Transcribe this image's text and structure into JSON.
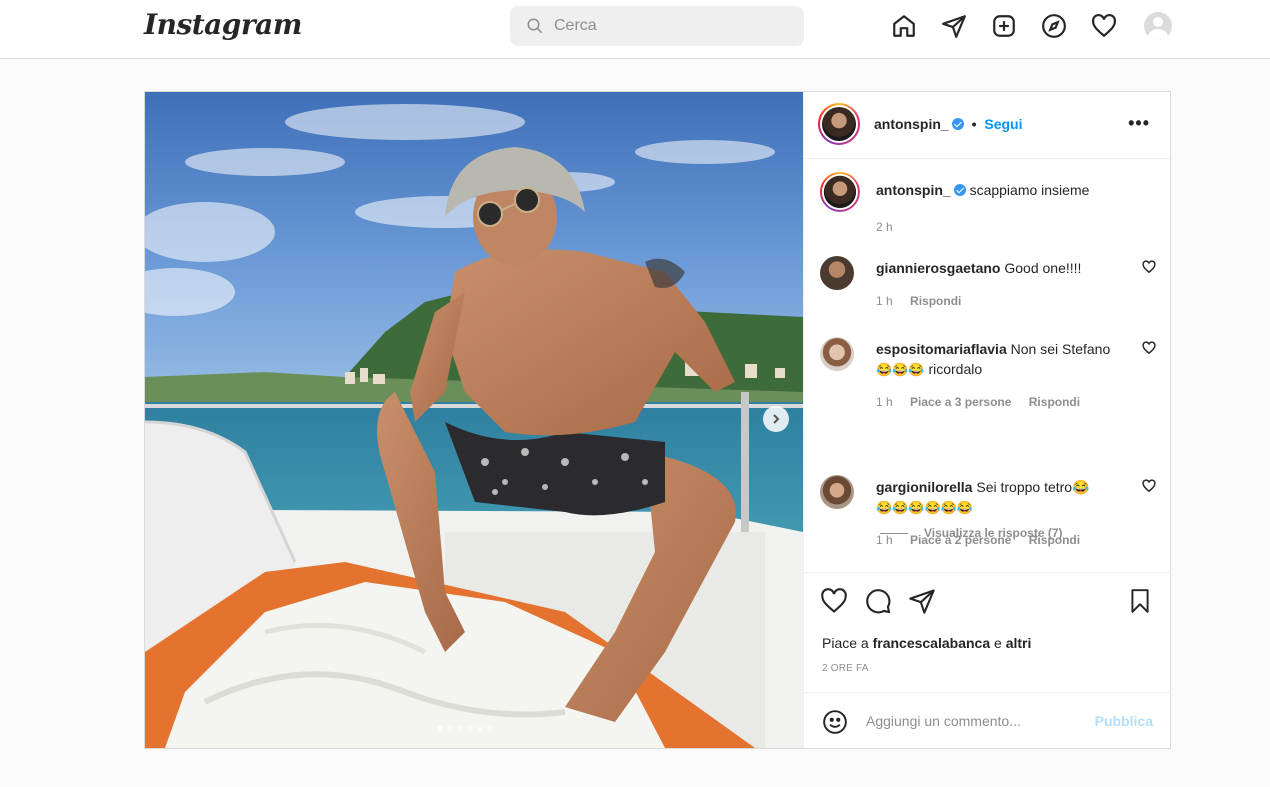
{
  "nav": {
    "logo": "Instagram",
    "search_placeholder": "Cerca",
    "icons": [
      "home-icon",
      "direct-icon",
      "new-post-icon",
      "explore-icon",
      "activity-icon",
      "profile-avatar"
    ]
  },
  "post": {
    "author": "antonspin_",
    "follow_label": "Segui",
    "separator": "•",
    "more_label": "•••",
    "caption": {
      "username": "antonspin_",
      "text": "scappiamo insieme",
      "time": "2 h"
    },
    "comments": [
      {
        "username": "giannierosgaetano",
        "text": "Good one!!!!",
        "time": "1 h",
        "likes": "",
        "reply_label": "Rispondi"
      },
      {
        "username": "espositomariaflavia",
        "text": "Non sei Stefano",
        "emoji_line": "😂😂😂",
        "text_after": "ricordalo",
        "time": "1 h",
        "likes": "Piace a 3 persone",
        "reply_label": "Rispondi",
        "view_replies": "Visualizza le risposte (7)"
      },
      {
        "username": "gargionilorella",
        "text": "Sei troppo tetro😂",
        "emoji_line": "😂😂😂😂😂😂",
        "time": "1 h",
        "likes": "Piace a 2 persone",
        "reply_label": "Rispondi"
      }
    ],
    "likes_prefix": "Piace a",
    "likes_user": "francescalabanca",
    "likes_conj": "e",
    "likes_others": "altri",
    "date": "2 ORE FA",
    "comment_placeholder": "Aggiungi un commento...",
    "publish_label": "Pubblica",
    "carousel": {
      "current": 1,
      "total": 6
    }
  },
  "colors": {
    "accent": "#0095f6",
    "verified": "#3897f0",
    "border": "#dbdbdb",
    "muted": "#8e8e8e",
    "publish_disabled": "#b2dffc"
  }
}
